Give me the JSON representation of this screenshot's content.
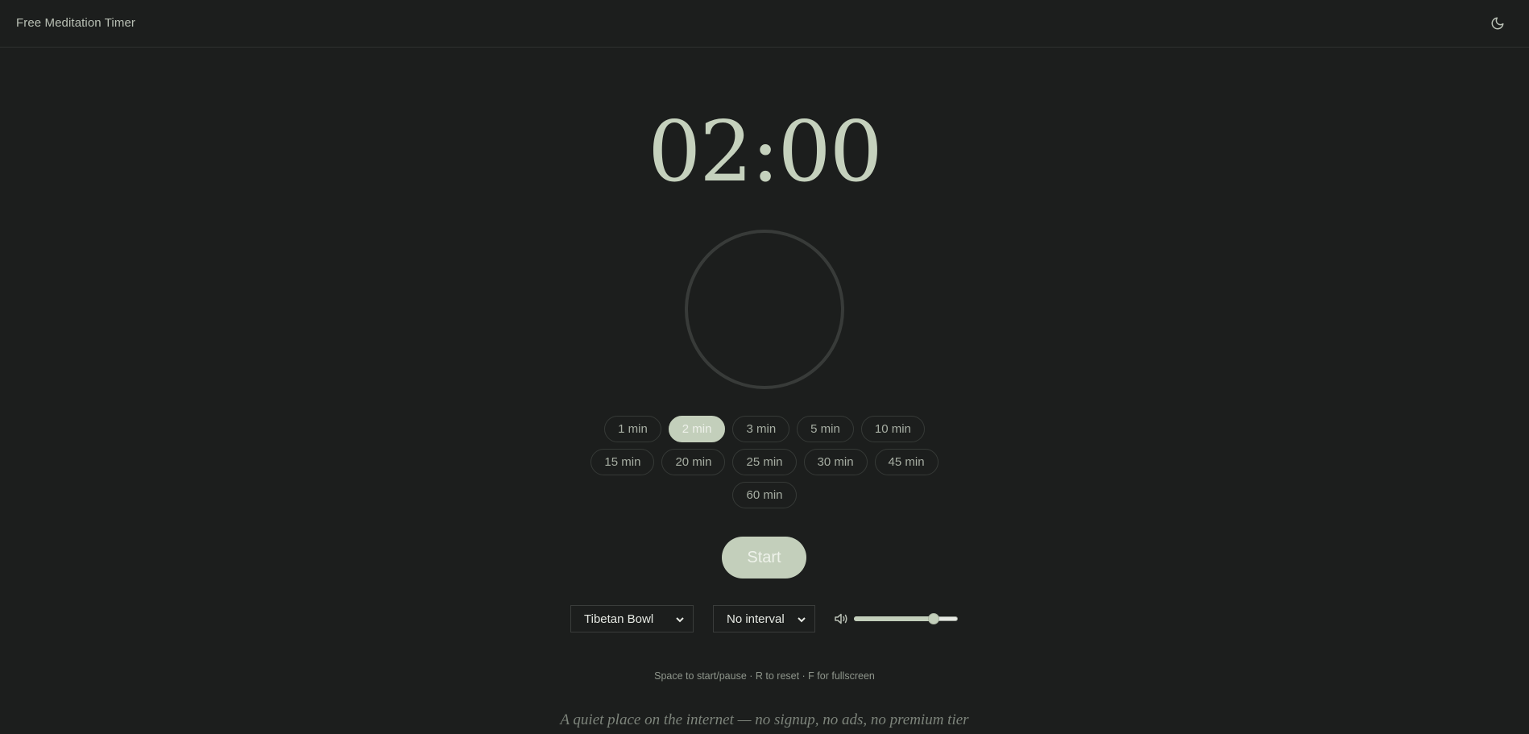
{
  "header": {
    "brand": "Free Meditation Timer",
    "theme_icon": "moon-icon"
  },
  "timer": {
    "display": "02:00",
    "progress": 0
  },
  "presets": {
    "rows": [
      [
        "1 min",
        "2 min",
        "3 min",
        "5 min",
        "10 min"
      ],
      [
        "15 min",
        "20 min",
        "25 min",
        "30 min",
        "45 min"
      ],
      [
        "60 min"
      ]
    ],
    "selected": "2 min"
  },
  "start_label": "Start",
  "controls": {
    "sound_value": "Tibetan Bowl",
    "interval_value": "No interval",
    "volume_icon": "speaker-icon",
    "volume_level": 0.8
  },
  "hint": "Space to start/pause · R to reset · F for fullscreen",
  "tagline": "A quiet place on the internet — no signup, no ads, no premium tier",
  "colors": {
    "background": "#1c1e1d",
    "accent": "#c3cfbb",
    "ring": "#383b39"
  }
}
